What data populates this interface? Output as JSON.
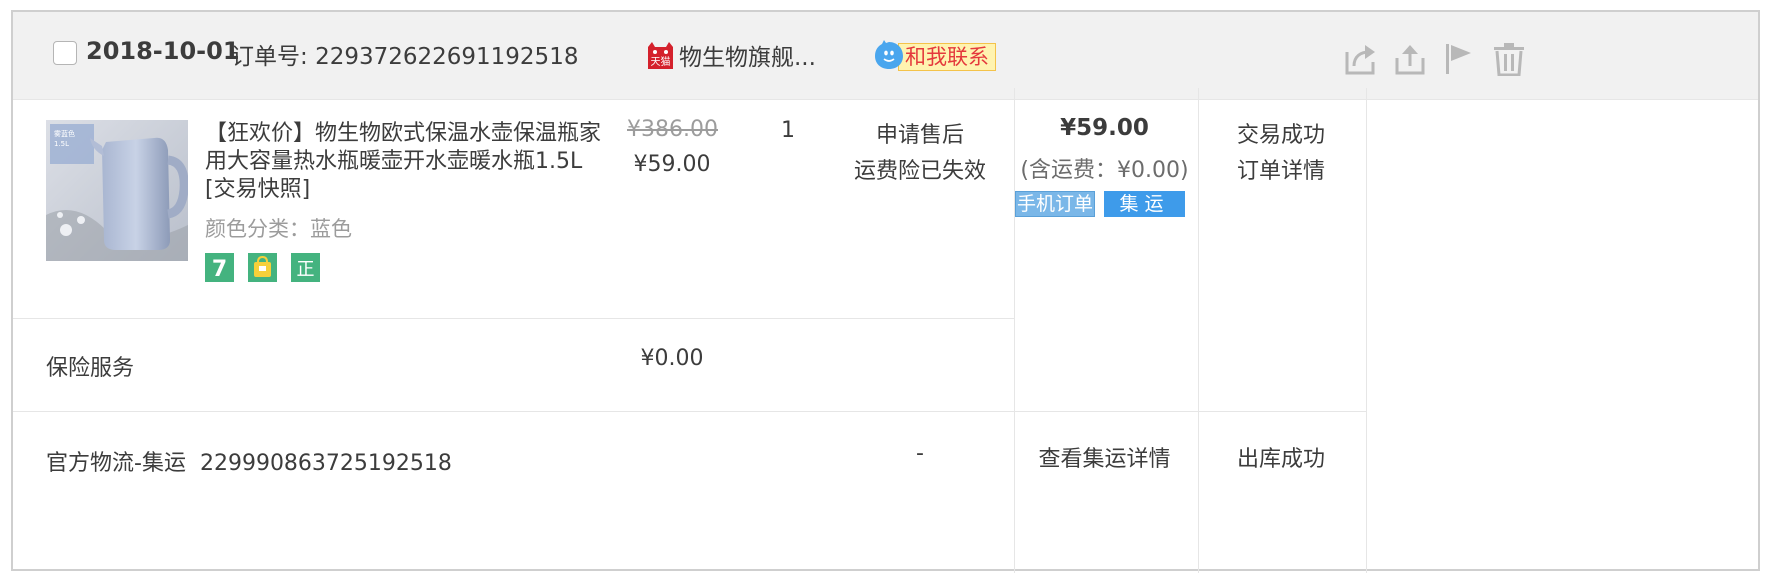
{
  "header": {
    "date": "2018-10-01",
    "order_label": "订单号:",
    "order_number": "229372622691192518",
    "tmall_badge": "天猫",
    "shop_name": "物生物旗舰...",
    "contact_label": "和我联系"
  },
  "header_icons": [
    "share-icon",
    "upload-icon",
    "flag-icon",
    "trash-icon"
  ],
  "product": {
    "title": "【狂欢价】物生物欧式保温水壶保温瓶家用大容量热水瓶暖壶开水壶暖水瓶1.5L",
    "snapshot": "[交易快照]",
    "attribute": "颜色分类：蓝色",
    "thumbnail_text": [
      "雾蓝色",
      "1.5L"
    ],
    "badges": [
      "7",
      "🛍",
      "正"
    ],
    "original_price": "¥386.00",
    "price": "¥59.00",
    "quantity": "1",
    "service_link": "申请售后",
    "service_note": "运费险已失效",
    "total": "¥59.00",
    "shipping": "(含运费：¥0.00)",
    "tag_mobile": "手机订单",
    "tag_consolidated": "集运",
    "status": "交易成功",
    "detail_link": "订单详情"
  },
  "insurance": {
    "label": "保险服务",
    "price": "¥0.00"
  },
  "logistics": {
    "label": "官方物流-集运",
    "tracking": "229990863725192518",
    "dash": "-",
    "detail_link": "查看集运详情",
    "status": "出库成功"
  },
  "colors": {
    "header_bg": "#f1f1f1",
    "border": "#cfcfcf",
    "grid": "#e6e6e6",
    "text": "#3c3c3c",
    "muted": "#9c9c9c",
    "badge_green": "#44b37f",
    "tag_blue": "#3e9bea",
    "contact_bg": "#fff3b0",
    "contact_text": "#e4393c",
    "tmall_red": "#d4212c"
  }
}
